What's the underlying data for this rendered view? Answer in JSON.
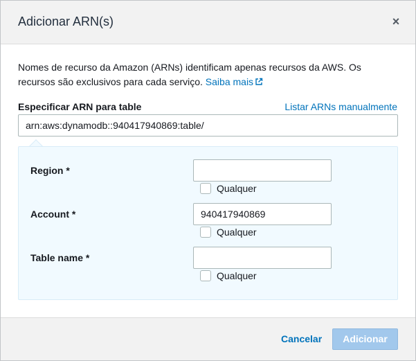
{
  "dialog": {
    "title": "Adicionar ARN(s)",
    "close_symbol": "×"
  },
  "description": {
    "text": "Nomes de recurso da Amazon (ARNs) identificam apenas recursos da AWS. Os recursos são exclusivos para cada serviço.",
    "link_label": "Saiba mais",
    "link_icon": "external-link-icon"
  },
  "arn_field": {
    "label": "Especificar ARN para table",
    "manual_link": "Listar ARNs manualmente",
    "value": "arn:aws:dynamodb::940417940869:table/"
  },
  "fields": {
    "region": {
      "label": "Region *",
      "value": "",
      "any_label": "Qualquer",
      "any_checked": false
    },
    "account": {
      "label": "Account *",
      "value": "940417940869",
      "any_label": "Qualquer",
      "any_checked": false
    },
    "table_name": {
      "label": "Table name *",
      "value": "",
      "any_label": "Qualquer",
      "any_checked": false
    }
  },
  "footer": {
    "cancel_label": "Cancelar",
    "add_label": "Adicionar"
  },
  "colors": {
    "link": "#0073bb",
    "panel_bg": "#f1faff",
    "primary_disabled": "#a2c8ec",
    "header_bg": "#f2f2f2"
  }
}
